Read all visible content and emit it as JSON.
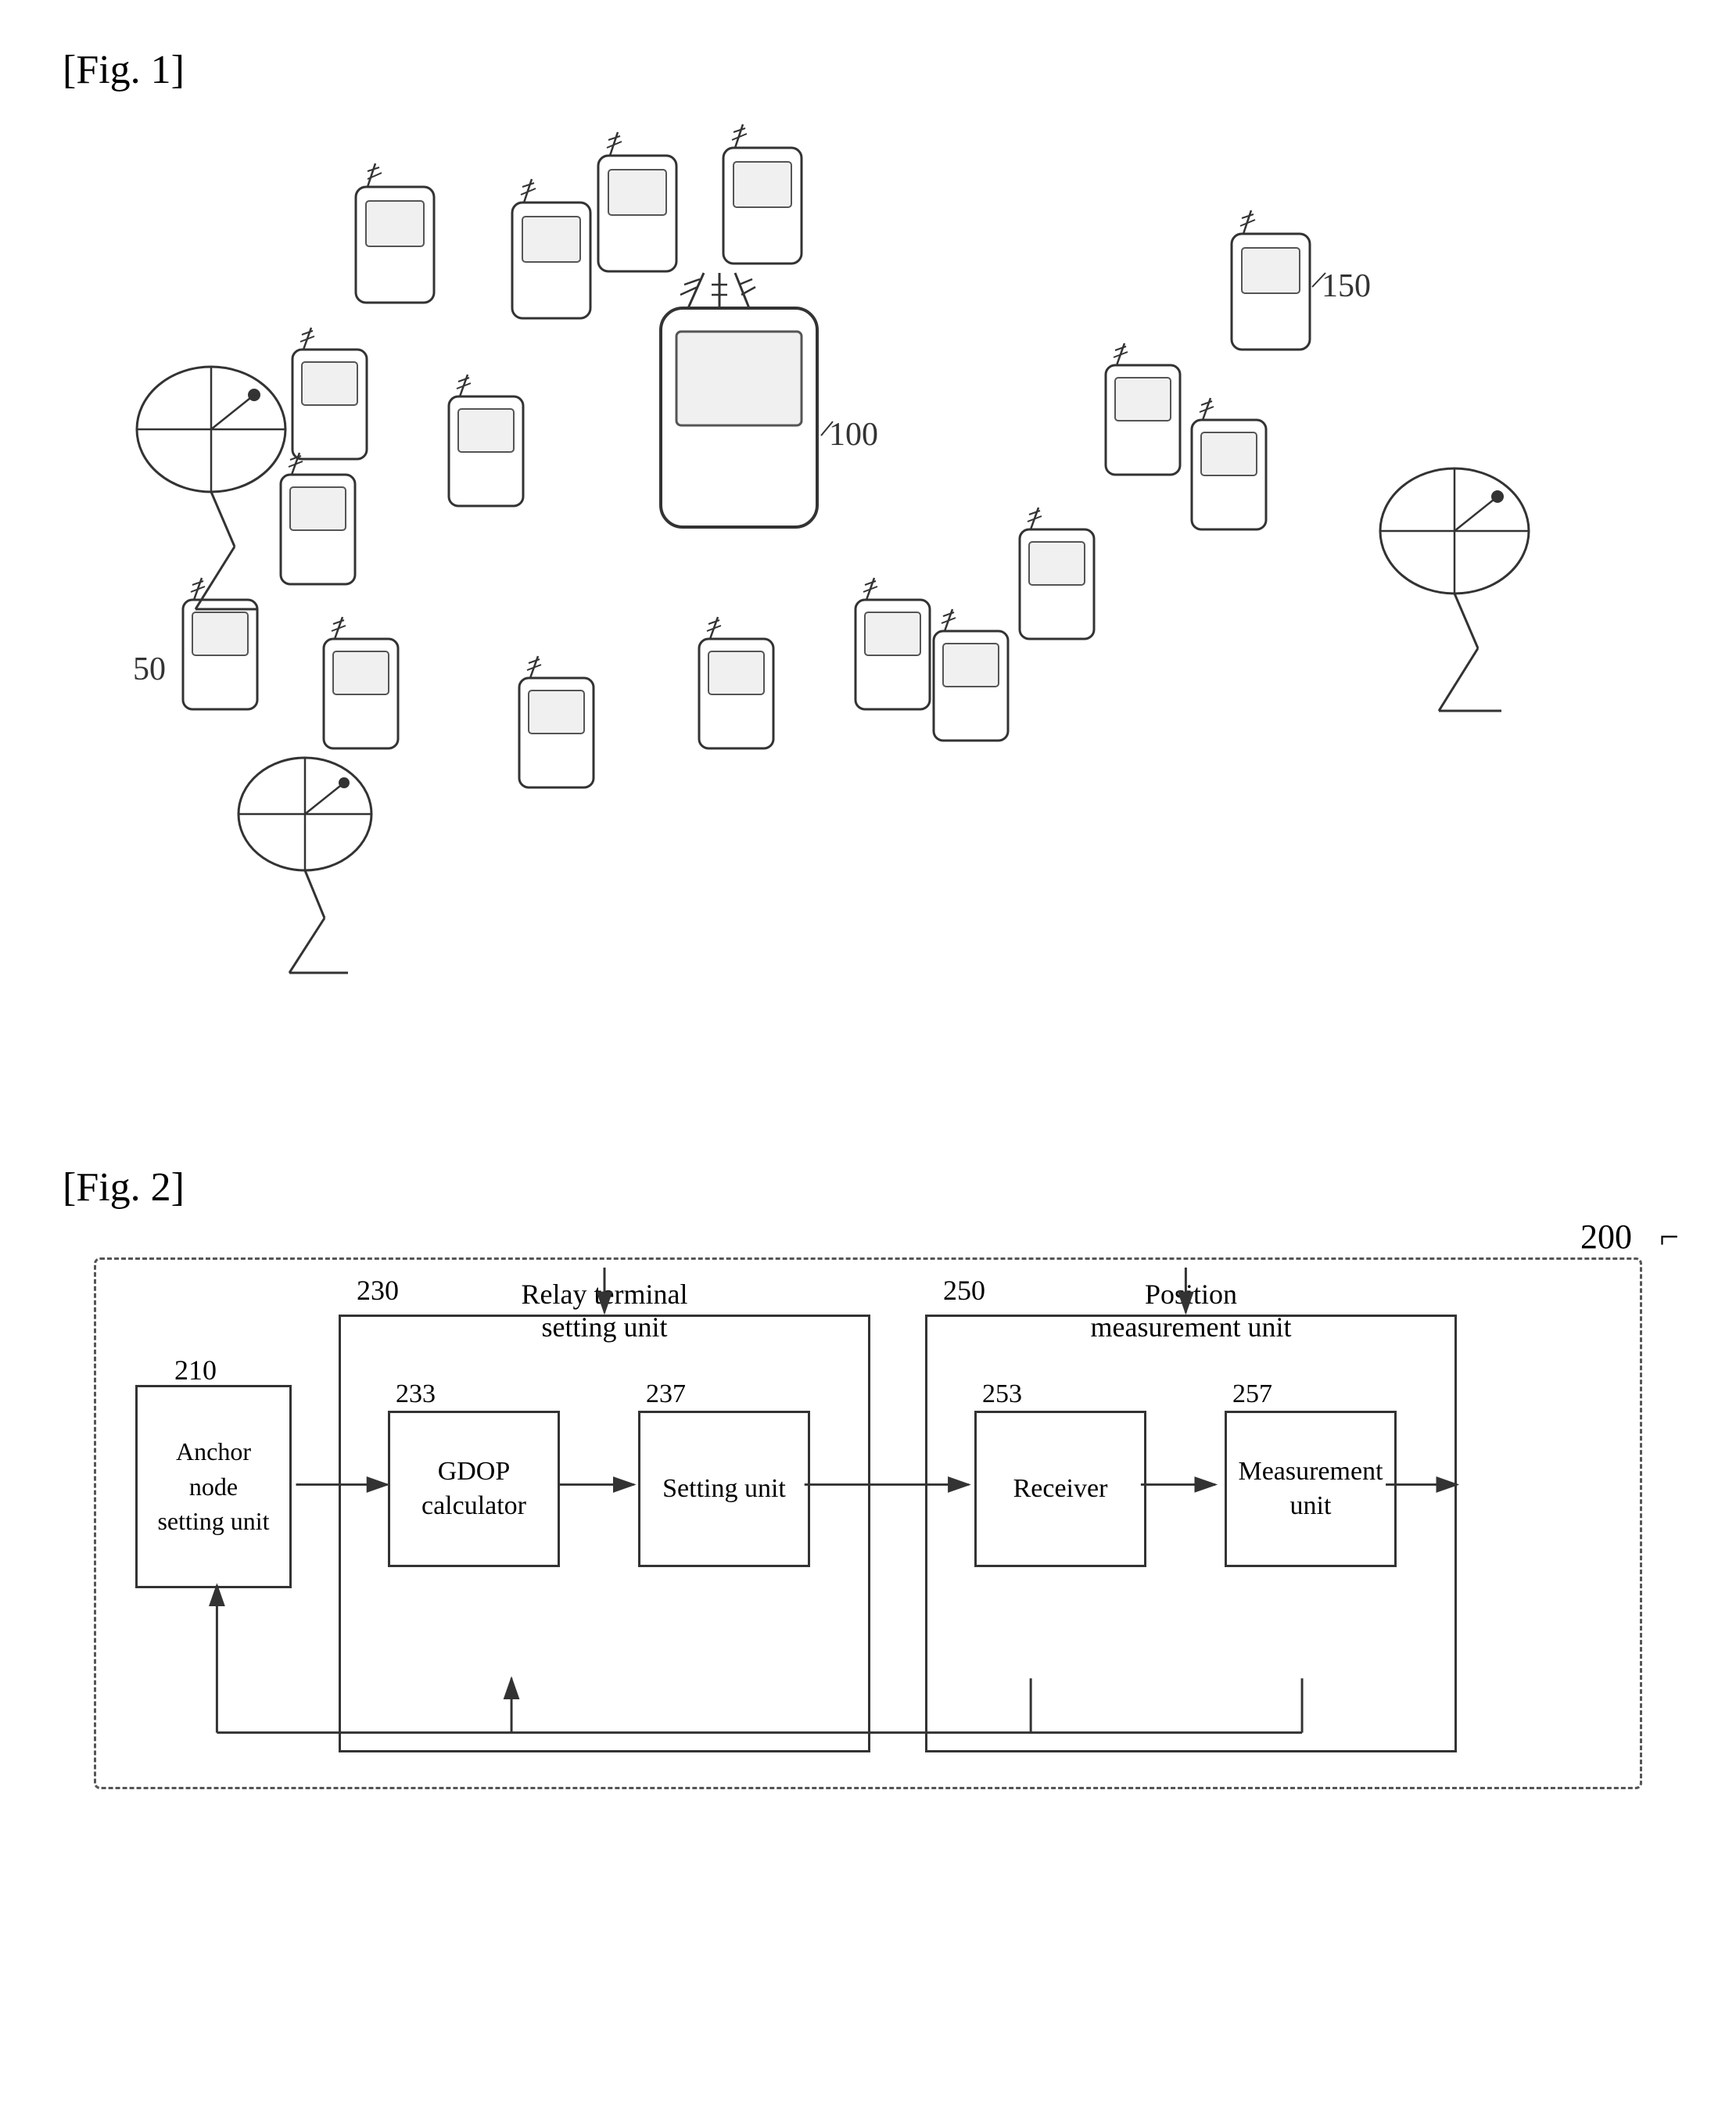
{
  "fig1": {
    "label": "[Fig. 1]",
    "labels": {
      "relay": "100",
      "satellite": "50",
      "anchor": "150"
    }
  },
  "fig2": {
    "label": "[Fig. 2]",
    "system_number": "200",
    "sections": {
      "relay_setting": {
        "label": "Relay terminal\nsetting unit",
        "number": "230"
      },
      "position_measurement": {
        "label": "Position\nmeasurement unit",
        "number": "250"
      }
    },
    "modules": {
      "anchor_node": {
        "label": "Anchor\nnode\nsetting unit",
        "number": "210"
      },
      "gdop": {
        "label": "GDOP\ncalculator",
        "number": "233"
      },
      "setting_unit": {
        "label": "Setting unit",
        "number": "237"
      },
      "receiver": {
        "label": "Receiver",
        "number": "253"
      },
      "measurement": {
        "label": "Measurement\nunit",
        "number": "257"
      }
    }
  }
}
